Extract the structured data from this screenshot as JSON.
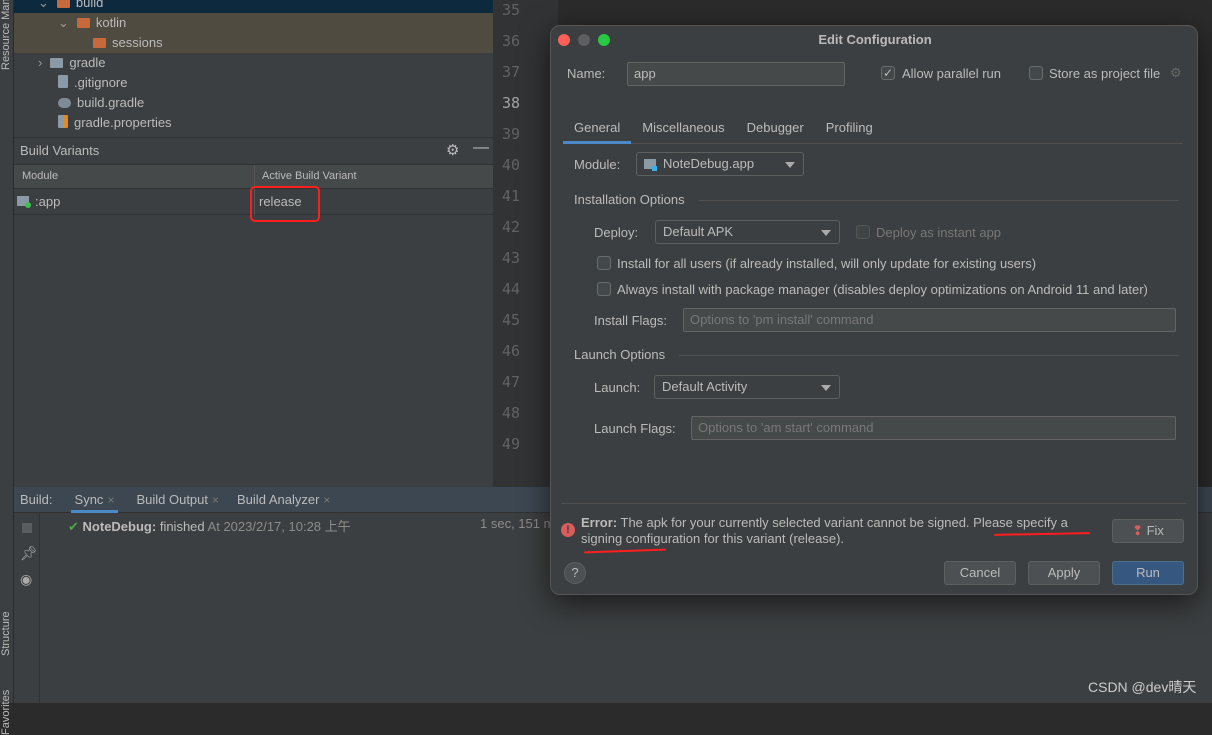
{
  "side_strip": {
    "top_label": "Resource Manager",
    "structure_label": "Structure",
    "favorites_label": "Favorites"
  },
  "project_tree": {
    "items": [
      {
        "name": "build",
        "type": "folder-excluded",
        "expanded": true
      },
      {
        "name": "kotlin",
        "type": "folder-excluded",
        "expanded": true
      },
      {
        "name": "sessions",
        "type": "folder-excluded"
      },
      {
        "name": "gradle",
        "type": "folder",
        "expanded": false
      },
      {
        "name": ".gitignore",
        "type": "ignore-file"
      },
      {
        "name": "build.gradle",
        "type": "gradle-file"
      },
      {
        "name": "gradle.properties",
        "type": "properties-file"
      }
    ]
  },
  "build_variants": {
    "title": "Build Variants",
    "columns": [
      "Module",
      "Active Build Variant"
    ],
    "rows": [
      {
        "module": ":app",
        "variant": "release"
      }
    ]
  },
  "editor": {
    "line_numbers": [
      "35",
      "36",
      "37",
      "38",
      "39",
      "40",
      "41",
      "42",
      "43",
      "44",
      "45",
      "46",
      "47",
      "48",
      "49"
    ],
    "current_line": "38"
  },
  "build_panel": {
    "label": "Build:",
    "tabs": [
      {
        "label": "Sync",
        "active": true
      },
      {
        "label": "Build Output"
      },
      {
        "label": "Build Analyzer"
      }
    ],
    "entry": {
      "name": "NoteDebug:",
      "status": "finished",
      "time": "At 2023/2/17, 10:28 上午",
      "duration": "1 sec, 151 m"
    }
  },
  "dialog": {
    "title": "Edit Configuration",
    "name_label": "Name:",
    "name_value": "app",
    "allow_parallel_label": "Allow parallel run",
    "allow_parallel_checked": true,
    "store_label": "Store as project file",
    "store_checked": false,
    "tabs": [
      "General",
      "Miscellaneous",
      "Debugger",
      "Profiling"
    ],
    "active_tab": "General",
    "module_label": "Module:",
    "module_value": "NoteDebug.app",
    "installation_title": "Installation Options",
    "deploy_label": "Deploy:",
    "deploy_value": "Default APK",
    "instant_label": "Deploy as instant app",
    "install_all_label": "Install for all users (if already installed, will only update for existing users)",
    "always_install_label": "Always install with package manager (disables deploy optimizations on Android 11 and later)",
    "install_flags_label": "Install Flags:",
    "install_flags_placeholder": "Options to 'pm install' command",
    "launch_title": "Launch Options",
    "launch_label": "Launch:",
    "launch_value": "Default Activity",
    "launch_flags_label": "Launch Flags:",
    "launch_flags_placeholder": "Options to 'am start' command",
    "error_prefix": "Error:",
    "error_text": "The apk for your currently selected variant cannot be signed. Please specify a signing configuration for this variant (release).",
    "fix_label": "Fix",
    "help_label": "?",
    "cancel_label": "Cancel",
    "apply_label": "Apply",
    "run_label": "Run"
  },
  "watermark": "CSDN @dev晴天",
  "colors": {
    "accent": "#4a88c7",
    "error": "#db5c5c",
    "annotation": "#ff1e1e",
    "run_button": "#365880"
  }
}
